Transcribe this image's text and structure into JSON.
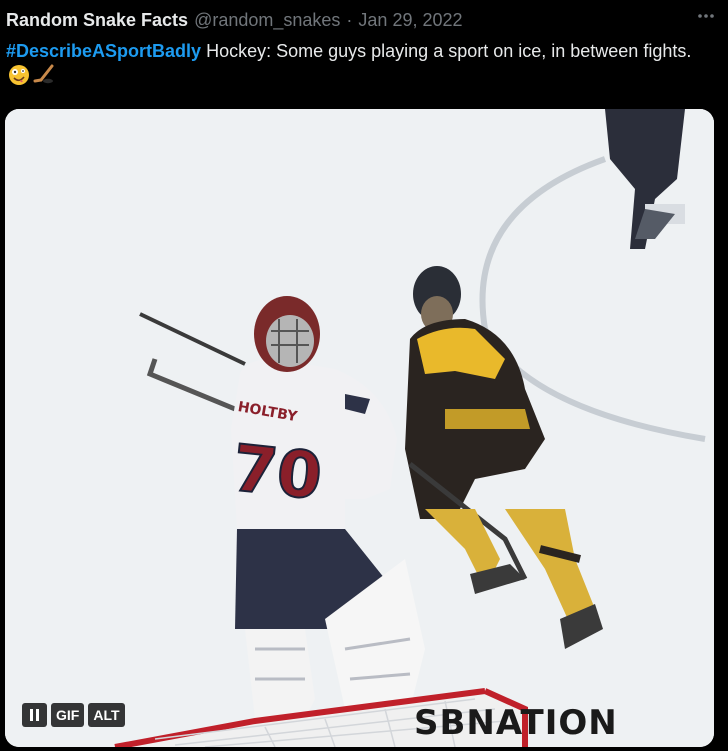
{
  "tweet": {
    "author_name": "Random Snake Facts",
    "handle": "@random_snakes",
    "separator": "·",
    "date": "Jan 29, 2022",
    "more_icon": "more-horizontal-icon",
    "hashtag": "#DescribeASportBadly",
    "body": " Hockey: Some guys playing a sport on ice, in between fights. ",
    "emojis": [
      "zany-face-emoji",
      "hockey-stick-emoji"
    ]
  },
  "media": {
    "type": "GIF",
    "jersey_name": "HOLTBY",
    "jersey_number": "70",
    "controls": {
      "pause_icon": "pause-icon",
      "gif_label": "GIF",
      "alt_label": "ALT"
    },
    "watermark": "SBNATION"
  },
  "colors": {
    "background": "#000000",
    "text": "#e7e9ea",
    "muted": "#71767b",
    "link": "#1d9bf0"
  }
}
